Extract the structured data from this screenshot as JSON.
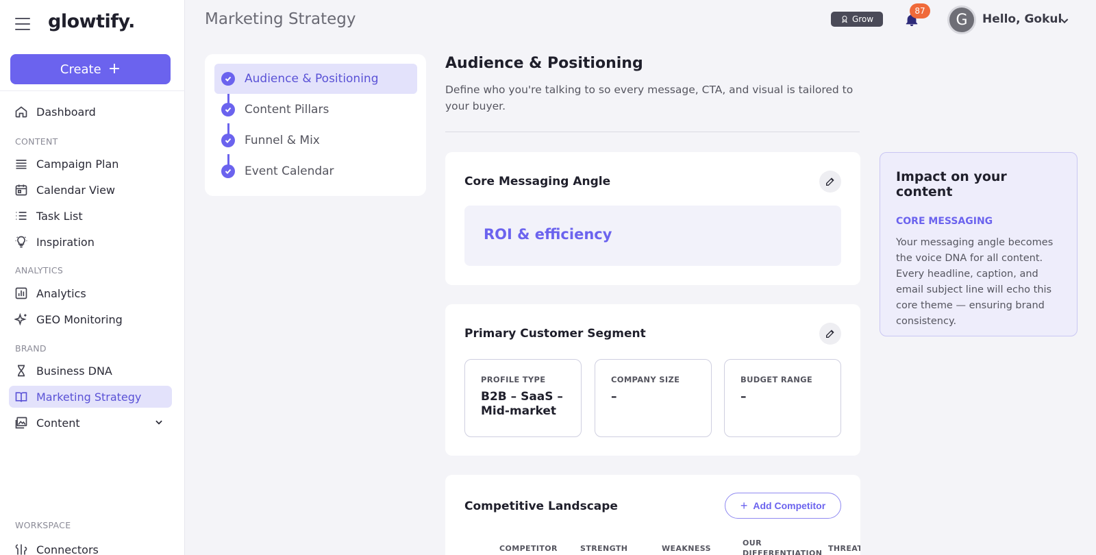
{
  "app": {
    "logo": "glowtify."
  },
  "sidebar": {
    "create_label": "Create",
    "items": [
      {
        "label": "Dashboard",
        "icon": "home-icon"
      },
      {
        "label": "Campaign Plan",
        "icon": "campaign-icon"
      },
      {
        "label": "Calendar View",
        "icon": "calendar-icon"
      },
      {
        "label": "Task List",
        "icon": "list-icon"
      },
      {
        "label": "Inspiration",
        "icon": "lightbulb-icon"
      },
      {
        "label": "Analytics",
        "icon": "analytics-icon"
      },
      {
        "label": "GEO Monitoring",
        "icon": "sparkle-icon"
      },
      {
        "label": "Business DNA",
        "icon": "dna-icon"
      },
      {
        "label": "Marketing Strategy",
        "icon": "book-icon",
        "active": true
      },
      {
        "label": "Content",
        "icon": "gallery-icon"
      },
      {
        "label": "Connectors",
        "icon": "connector-icon"
      }
    ],
    "sections": {
      "content": "CONTENT",
      "analytics": "ANALYTICS",
      "brand": "BRAND",
      "workspace": "WORKSPACE"
    }
  },
  "header": {
    "title": "Marketing Strategy",
    "grow_label": "Grow",
    "notification_count": "87",
    "avatar_initial": "G",
    "greeting": "Hello, Gokul"
  },
  "steps": [
    {
      "label": "Audience & Positioning",
      "active": true
    },
    {
      "label": "Content Pillars"
    },
    {
      "label": "Funnel & Mix"
    },
    {
      "label": "Event Calendar"
    }
  ],
  "main": {
    "title": "Audience & Positioning",
    "description": "Define who you're talking to so every message, CTA, and visual is tailored to your buyer.",
    "core_messaging": {
      "title": "Core Messaging Angle",
      "value": "ROI & efficiency"
    },
    "segment": {
      "title": "Primary Customer Segment",
      "fields": [
        {
          "label": "PROFILE TYPE",
          "value": "B2B – SaaS – Mid-market"
        },
        {
          "label": "COMPANY SIZE",
          "value": "–"
        },
        {
          "label": "BUDGET RANGE",
          "value": "–"
        }
      ]
    },
    "competitive": {
      "title": "Competitive Landscape",
      "add_label": "Add Competitor",
      "columns": [
        "COMPETITOR",
        "STRENGTH",
        "WEAKNESS",
        "OUR DIFFERENTIATION",
        "THREAT"
      ]
    }
  },
  "impact": {
    "title": "Impact on your content",
    "subtitle": "CORE MESSAGING",
    "body": "Your messaging angle becomes the voice DNA for all content. Every headline, caption, and email subject line will echo this core theme — ensuring brand consistency."
  },
  "colors": {
    "accent": "#6b63ee",
    "accent_soft": "#e3e2fb",
    "badge": "#f06a3a"
  }
}
